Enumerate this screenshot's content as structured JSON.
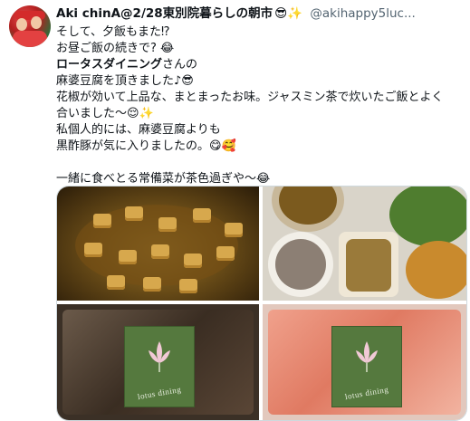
{
  "tweet": {
    "author_name": "Aki chinA@2/28東別院暮らしの朝市",
    "author_emoji": "😎✨",
    "handle": "@akihappy5luc...",
    "lines": [
      "そして、夕飯もまた⁉",
      "お昼ご飯の続きで? 😂",
      "ロータスダイニングさんの",
      "麻婆豆腐を頂きました♪😎",
      "花椒が効いて上品な、まとまったお味。ジャスミン茶で炊いたご飯とよく",
      "合いました〜😌✨",
      "私個人的には、麻婆豆腐よりも",
      "黒酢豚が気に入りましたの。😋🥰",
      "",
      "一緒に食べとる常備菜が茶色過ぎや〜😂"
    ],
    "bold_segment": "ロータスダイニング",
    "after_bold": "さんの"
  },
  "media": {
    "label_text_1": "lotus dining",
    "label_text_2": "lotus dining"
  }
}
